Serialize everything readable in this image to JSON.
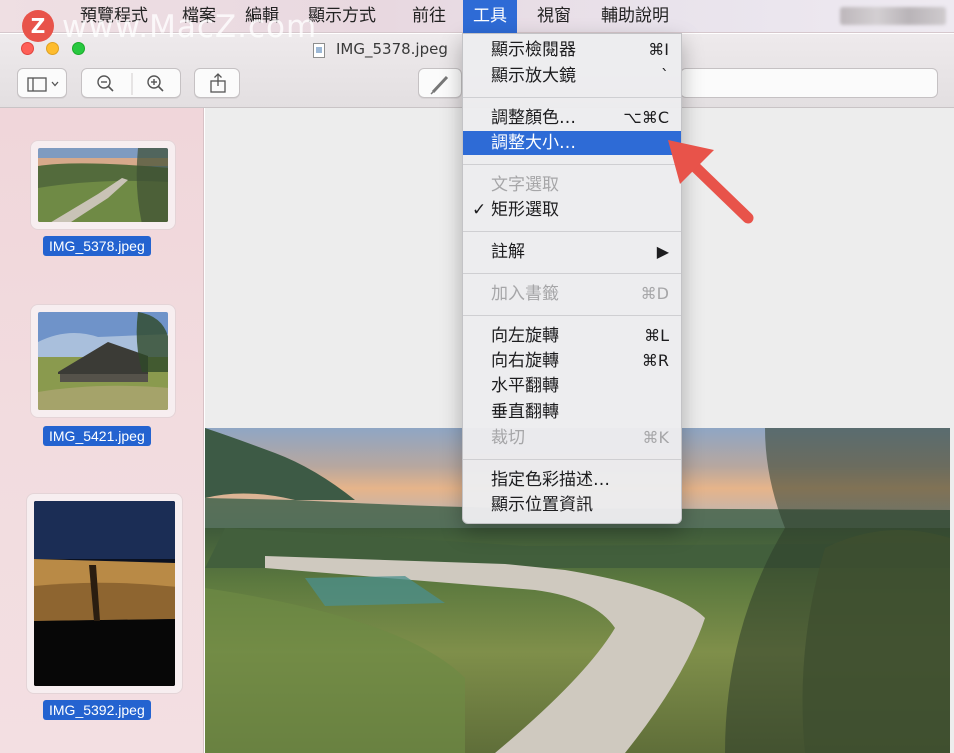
{
  "watermark": {
    "logo": "Z",
    "text": "www.MacZ.com"
  },
  "menubar": {
    "apple": "",
    "items": [
      "預覽程式",
      "檔案",
      "編輯",
      "顯示方式",
      "前往",
      "工具",
      "視窗",
      "輔助說明"
    ]
  },
  "window": {
    "title": "IMG_5378.jpeg"
  },
  "sidebar": {
    "thumbnails": [
      {
        "label": "IMG_5378.jpeg"
      },
      {
        "label": "IMG_5421.jpeg"
      },
      {
        "label": "IMG_5392.jpeg"
      }
    ]
  },
  "tools_menu": {
    "items": [
      {
        "label": "顯示檢閱器",
        "shortcut": "⌘I",
        "state": "enabled"
      },
      {
        "label": "顯示放大鏡",
        "shortcut": "`",
        "state": "enabled"
      },
      {
        "label": "調整顏色…",
        "shortcut": "⌥⌘C",
        "state": "enabled"
      },
      {
        "label": "調整大小…",
        "shortcut": "",
        "state": "highlighted"
      },
      {
        "label": "文字選取",
        "shortcut": "",
        "state": "disabled"
      },
      {
        "label": "矩形選取",
        "shortcut": "",
        "state": "checked",
        "check": "✓"
      },
      {
        "label": "註解",
        "shortcut": "▶",
        "state": "enabled"
      },
      {
        "label": "加入書籤",
        "shortcut": "⌘D",
        "state": "disabled"
      },
      {
        "label": "向左旋轉",
        "shortcut": "⌘L",
        "state": "enabled"
      },
      {
        "label": "向右旋轉",
        "shortcut": "⌘R",
        "state": "enabled"
      },
      {
        "label": "水平翻轉",
        "shortcut": "",
        "state": "enabled"
      },
      {
        "label": "垂直翻轉",
        "shortcut": "",
        "state": "enabled"
      },
      {
        "label": "裁切",
        "shortcut": "⌘K",
        "state": "disabled"
      },
      {
        "label": "指定色彩描述…",
        "shortcut": "",
        "state": "enabled"
      },
      {
        "label": "顯示位置資訊",
        "shortcut": "",
        "state": "enabled"
      }
    ]
  },
  "colors": {
    "accent": "#2e6bd6",
    "annotation_arrow": "#e8534a"
  },
  "icons": [
    "apple-icon",
    "sidebar-toggle-icon",
    "zoom-out-icon",
    "zoom-in-icon",
    "share-icon",
    "markup-pen-icon",
    "document-icon",
    "arrow-annotation"
  ]
}
